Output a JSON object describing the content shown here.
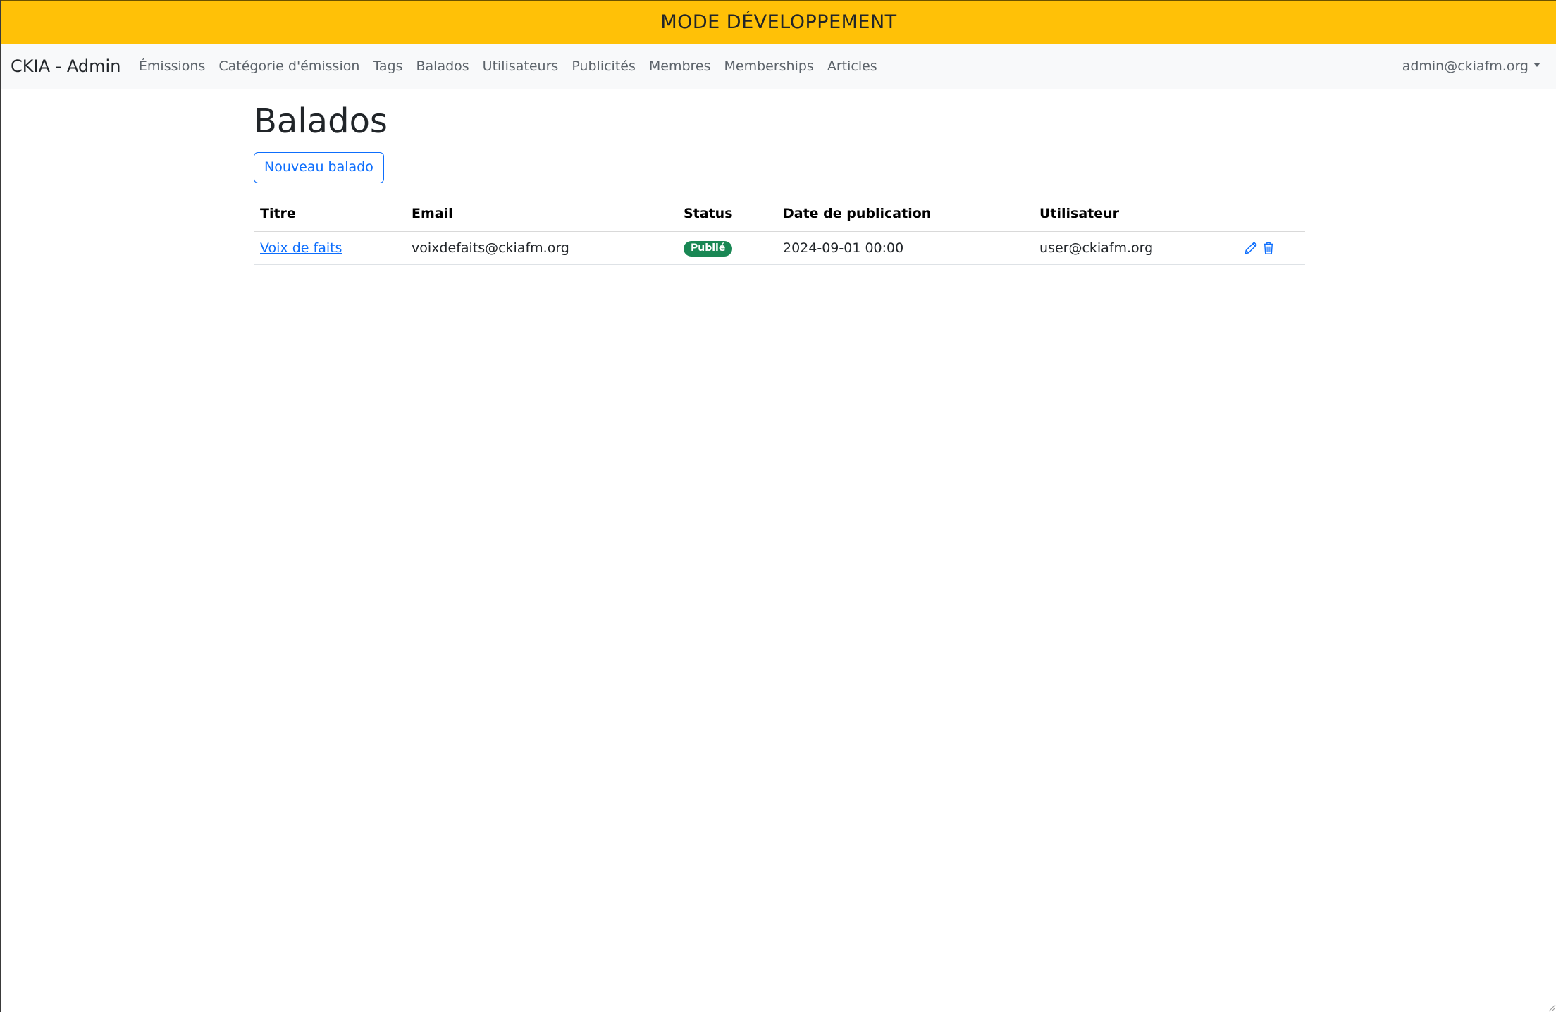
{
  "dev_banner": {
    "text": "MODE DÉVELOPPEMENT",
    "color": "#ffc107"
  },
  "navbar": {
    "brand": "CKIA - Admin",
    "links": [
      {
        "label": "Émissions"
      },
      {
        "label": "Catégorie d'émission"
      },
      {
        "label": "Tags"
      },
      {
        "label": "Balados"
      },
      {
        "label": "Utilisateurs"
      },
      {
        "label": "Publicités"
      },
      {
        "label": "Membres"
      },
      {
        "label": "Memberships"
      },
      {
        "label": "Articles"
      }
    ],
    "user_menu": {
      "label": "admin@ckiafm.org",
      "icon": "caret-down-icon"
    }
  },
  "main": {
    "title": "Balados",
    "new_button_label": "Nouveau balado",
    "table": {
      "columns": [
        "Titre",
        "Email",
        "Status",
        "Date de publication",
        "Utilisateur",
        ""
      ],
      "rows": [
        {
          "titre": "Voix de faits",
          "email": "voixdefaits@ckiafm.org",
          "status": "Publié",
          "date": "2024-09-01 00:00",
          "utilisateur": "user@ckiafm.org",
          "actions": [
            "pencil-icon",
            "trash-icon"
          ]
        }
      ]
    }
  },
  "colors": {
    "primary": "#0d6efd",
    "success": "#198754",
    "navbar_bg": "#f8f9fa"
  }
}
